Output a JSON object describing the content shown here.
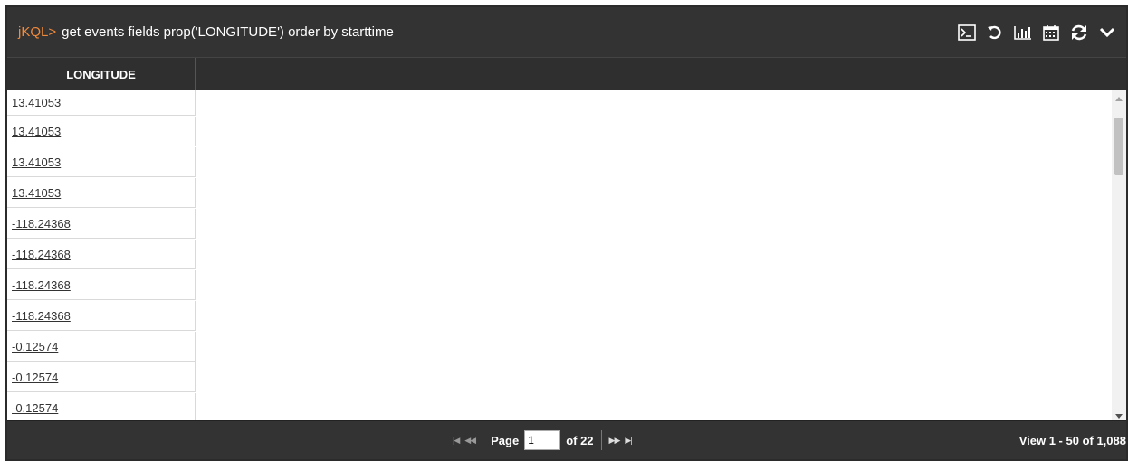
{
  "titlebar": {
    "prompt": "jKQL>",
    "query": "get events fields prop('LONGITUDE') order by starttime",
    "icons": [
      "terminal-icon",
      "undo-icon",
      "bar-chart-icon",
      "calendar-icon",
      "refresh-icon",
      "chevron-down-icon"
    ]
  },
  "grid": {
    "column_header": "LONGITUDE",
    "rows": [
      "13.41053",
      "13.41053",
      "13.41053",
      "13.41053",
      "-118.24368",
      "-118.24368",
      "-118.24368",
      "-118.24368",
      "-0.12574",
      "-0.12574",
      "-0.12574"
    ]
  },
  "pager": {
    "page_label": "Page",
    "page_value": "1",
    "of_label": "of 22",
    "view_info": "View 1 - 50 of 1,088"
  }
}
